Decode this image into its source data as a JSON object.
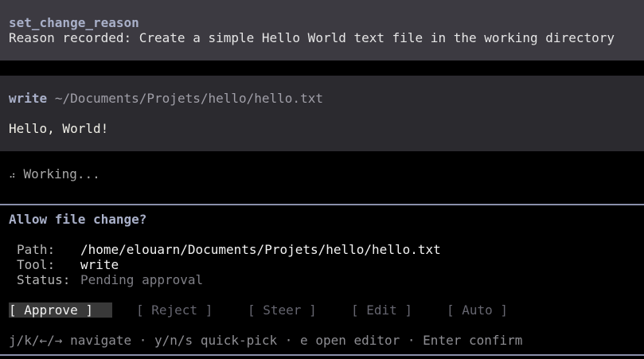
{
  "reason_block": {
    "tool_name": "set_change_reason",
    "message": "Reason recorded: Create a simple Hello World text file in the working directory"
  },
  "write_block": {
    "tool_name": "write",
    "path": "~/Documents/Projets/hello/hello.txt",
    "content": "Hello, World!"
  },
  "status": {
    "spinner_icon": "braille-spinner-icon",
    "spinner": "⠴",
    "text": "Working..."
  },
  "approval": {
    "title": "Allow file change?",
    "fields": {
      "path_label": "Path:",
      "path_value": "/home/elouarn/Documents/Projets/hello/hello.txt",
      "tool_label": "Tool:",
      "tool_value": "write",
      "status_label": "Status:",
      "status_value": "Pending approval"
    },
    "options": {
      "approve": "[ Approve ]",
      "reject": "[ Reject ]",
      "steer": "[ Steer ]",
      "edit": "[ Edit ]",
      "auto": "[ Auto ]",
      "selected": "approve"
    },
    "hint": "j/k/←/→ navigate · y/n/s quick-pick · e open editor · Enter confirm"
  },
  "colors": {
    "background": "#000000",
    "reason_block_bg": "#3c3a41",
    "write_block_bg": "#2b2a2f",
    "accent": "#a9b0c9",
    "rule": "#8a8fab",
    "selected_bg": "#393939"
  }
}
